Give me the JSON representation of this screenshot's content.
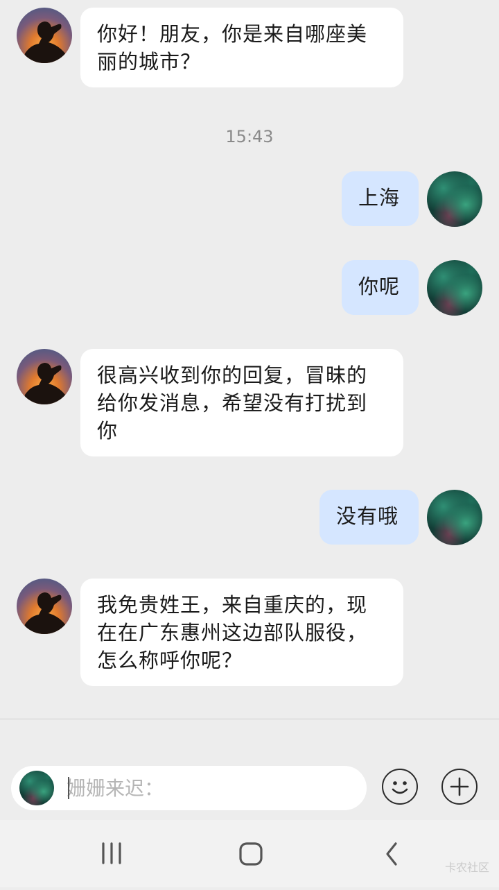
{
  "messages": [
    {
      "side": "peer",
      "text": "你好！朋友，你是来自哪座美丽的城市？"
    },
    {
      "type": "timestamp",
      "text": "15:43"
    },
    {
      "side": "self",
      "text": "上海"
    },
    {
      "side": "self",
      "text": "你呢"
    },
    {
      "side": "peer",
      "text": "很高兴收到你的回复，冒昧的给你发消息，希望没有打扰到你"
    },
    {
      "side": "self",
      "text": "没有哦"
    },
    {
      "side": "peer",
      "text": "我免贵姓王，来自重庆的，现在在广东惠州这边部队服役，怎么称呼你呢？"
    }
  ],
  "composer": {
    "placeholder": "姗姗来迟：",
    "emoji_icon": "smiley-icon",
    "add_icon": "plus-icon"
  },
  "navbar": {
    "recents_icon": "recents-icon",
    "home_icon": "home-icon",
    "back_icon": "back-icon"
  },
  "watermark": "卡农社区",
  "colors": {
    "background": "#ededed",
    "peer_bubble": "#ffffff",
    "self_bubble": "#d5e6ff"
  }
}
